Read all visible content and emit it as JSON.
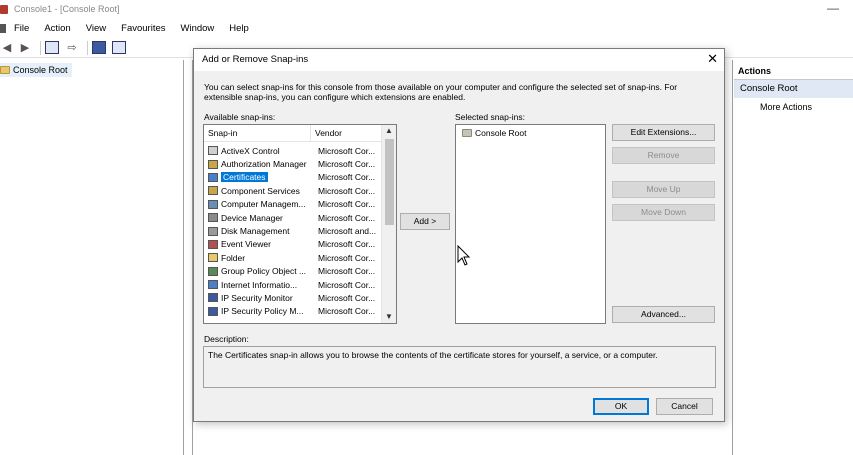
{
  "window": {
    "title": "Console1 - [Console Root]",
    "minimize": "—"
  },
  "menu": [
    "File",
    "Action",
    "View",
    "Favourites",
    "Window",
    "Help"
  ],
  "tree": {
    "root_label": "Console Root"
  },
  "actions": {
    "header": "Actions",
    "section": "Console Root",
    "more": "More Actions"
  },
  "dialog": {
    "title": "Add or Remove Snap-ins",
    "close": "✕",
    "intro": "You can select snap-ins for this console from those available on your computer and configure the selected set of snap-ins. For extensible snap-ins, you can configure which extensions are enabled.",
    "available_label": "Available snap-ins:",
    "selected_label": "Selected snap-ins:",
    "columns": {
      "snapin": "Snap-in",
      "vendor": "Vendor"
    },
    "snapins": [
      {
        "name": "ActiveX Control",
        "vendor": "Microsoft Cor..."
      },
      {
        "name": "Authorization Manager",
        "vendor": "Microsoft Cor..."
      },
      {
        "name": "Certificates",
        "vendor": "Microsoft Cor..."
      },
      {
        "name": "Component Services",
        "vendor": "Microsoft Cor..."
      },
      {
        "name": "Computer Managem...",
        "vendor": "Microsoft Cor..."
      },
      {
        "name": "Device Manager",
        "vendor": "Microsoft Cor..."
      },
      {
        "name": "Disk Management",
        "vendor": "Microsoft and..."
      },
      {
        "name": "Event Viewer",
        "vendor": "Microsoft Cor..."
      },
      {
        "name": "Folder",
        "vendor": "Microsoft Cor..."
      },
      {
        "name": "Group Policy Object ...",
        "vendor": "Microsoft Cor..."
      },
      {
        "name": "Internet Informatio...",
        "vendor": "Microsoft Cor..."
      },
      {
        "name": "IP Security Monitor",
        "vendor": "Microsoft Cor..."
      },
      {
        "name": "IP Security Policy M...",
        "vendor": "Microsoft Cor..."
      }
    ],
    "selected_index": 2,
    "selected_snapins": [
      "Console Root"
    ],
    "buttons": {
      "add": "Add >",
      "edit_extensions": "Edit Extensions...",
      "remove": "Remove",
      "move_up": "Move Up",
      "move_down": "Move Down",
      "advanced": "Advanced...",
      "ok": "OK",
      "cancel": "Cancel"
    },
    "description_label": "Description:",
    "description": "The Certificates snap-in allows you to browse the contents of the certificate stores for yourself, a service, or a computer."
  }
}
